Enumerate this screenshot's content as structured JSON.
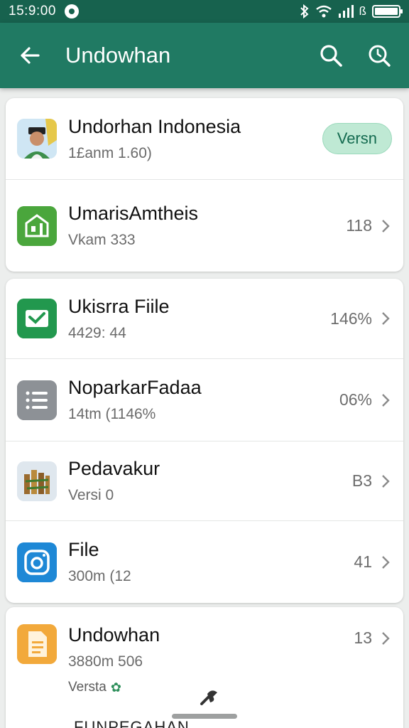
{
  "status_bar": {
    "time": "15:9:00",
    "indicator": "ß"
  },
  "app_bar": {
    "title": "Undowhan"
  },
  "card1": {
    "rows": [
      {
        "title": "Undorhan Indonesia",
        "subtitle": "1£anm 1.60)",
        "action": "Versn"
      },
      {
        "title": "UmarisAmtheis",
        "subtitle": "Vkam 333",
        "meta": "118"
      }
    ]
  },
  "card2": {
    "rows": [
      {
        "title": "Ukisrra Fiile",
        "subtitle": "4429: 44",
        "meta": "146%"
      },
      {
        "title": "NoparkarFadaa",
        "subtitle": "14tm (1146%",
        "meta": "06%"
      },
      {
        "title": "Pedavakur",
        "subtitle": "Versi 0",
        "meta": "B3"
      },
      {
        "title": "File",
        "subtitle": "300m (12",
        "meta": "41"
      }
    ]
  },
  "card3": {
    "row": {
      "title": "Undowhan",
      "subtitle": "3880m 506",
      "meta": "13"
    },
    "extra_label": "Versta",
    "cut_text": "FUNPEGAHAN"
  },
  "colors": {
    "status_bar": "#17624e",
    "app_bar": "#207a63",
    "accent_green": "#2e9a52",
    "pill_bg": "#bfe9d4"
  }
}
